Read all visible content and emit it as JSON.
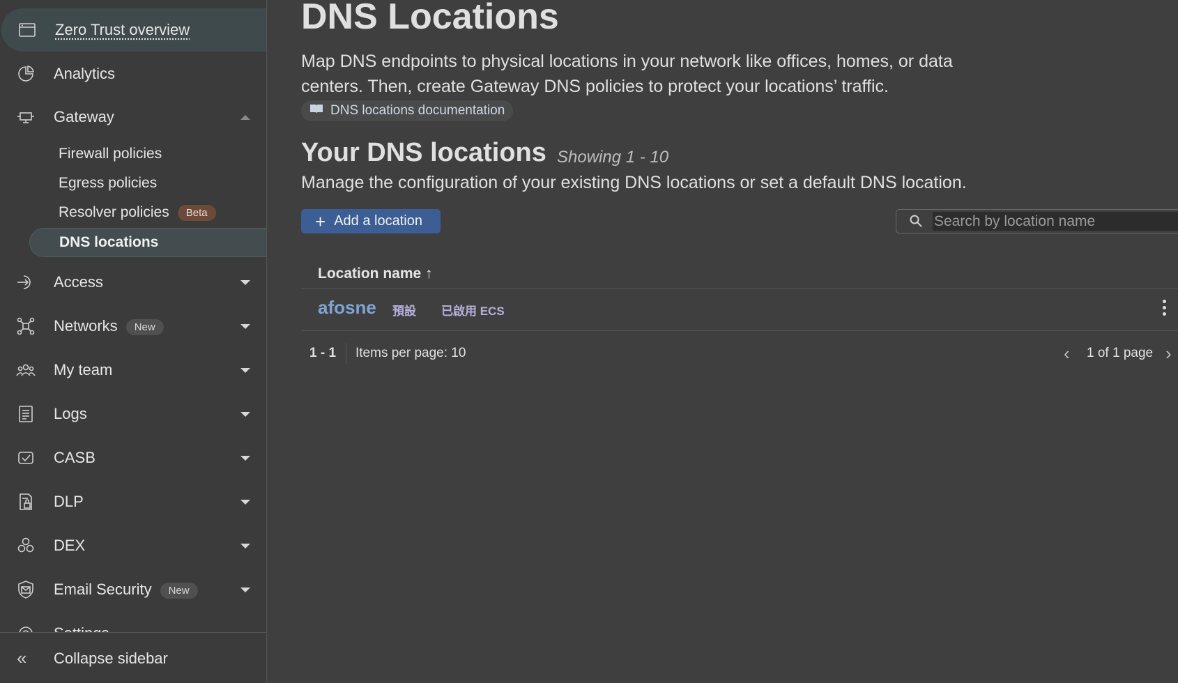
{
  "sidebar": {
    "items": [
      {
        "label": "Zero Trust overview",
        "icon": "browser-window-icon",
        "active": true
      },
      {
        "label": "Analytics",
        "icon": "pie-chart-icon"
      },
      {
        "label": "Gateway",
        "icon": "gateway-icon",
        "expanded": true
      },
      {
        "label": "Access",
        "icon": "sign-in-arrow-icon"
      },
      {
        "label": "Networks",
        "icon": "network-nodes-icon",
        "badge": "New"
      },
      {
        "label": "My team",
        "icon": "team-users-icon"
      },
      {
        "label": "Logs",
        "icon": "log-list-icon"
      },
      {
        "label": "CASB",
        "icon": "casb-check-icon"
      },
      {
        "label": "DLP",
        "icon": "document-lock-icon"
      },
      {
        "label": "DEX",
        "icon": "dex-circles-icon"
      },
      {
        "label": "Email Security",
        "icon": "envelope-shield-icon",
        "badge": "New"
      },
      {
        "label": "Settings",
        "icon": "gear-icon"
      }
    ],
    "gateway_sub": [
      {
        "label": "Firewall policies"
      },
      {
        "label": "Egress policies"
      },
      {
        "label": "Resolver policies",
        "badge": "Beta"
      },
      {
        "label": "DNS locations",
        "active": true
      }
    ],
    "collapse_label": "Collapse sidebar"
  },
  "main": {
    "title": "DNS Locations",
    "description": "Map DNS endpoints to physical locations in your network like offices, homes, or data centers. Then, create Gateway DNS policies to protect your locations’ traffic.",
    "doc_link": "DNS locations documentation",
    "section_title": "Your DNS locations",
    "showing": "Showing 1 - 10",
    "section_desc": "Manage the configuration of your existing DNS locations or set a default DNS location.",
    "add_button": "Add a location",
    "search_placeholder": "Search by location name",
    "table": {
      "column_header": "Location name ↑",
      "rows": [
        {
          "name": "afosne",
          "tags": [
            "預設",
            "已啟用 ECS"
          ]
        }
      ]
    },
    "pagination": {
      "range": "1 - 1",
      "items_per_page": "Items per page: 10",
      "page_info": "1 of 1 page"
    }
  },
  "colors": {
    "background": "#3f3f3f",
    "sidebar": "#3b3b3b",
    "accent_button": "#3d5e94",
    "link": "#7fa4d4",
    "tag_text": "#b7b0db",
    "beta_badge": "#6b4a3a"
  }
}
